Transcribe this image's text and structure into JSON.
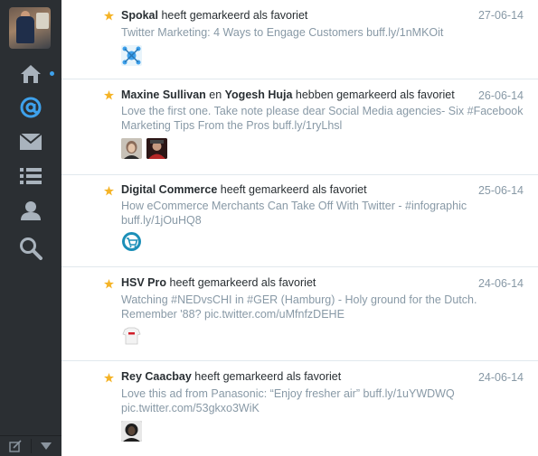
{
  "sidebar": {
    "icons": [
      "home-icon",
      "mentions-icon",
      "messages-icon",
      "lists-icon",
      "profile-icon",
      "search-icon"
    ],
    "accent": "#3ea1ec",
    "icon_color": "#a9b3bd",
    "bottom": [
      "compose-icon",
      "dropdown-icon"
    ]
  },
  "items": [
    {
      "pre": "",
      "b1": "Spokal",
      "mid": "",
      "b2": "",
      "post": " heeft gemarkeerd als favoriet",
      "date": "27-06-14",
      "text": "Twitter Marketing: 4 Ways to Engage Customers buff.ly/1nMKOit"
    },
    {
      "pre": "",
      "b1": "Maxine Sullivan",
      "mid": " en ",
      "b2": "Yogesh Huja",
      "post": " hebben gemarkeerd als favoriet",
      "date": "26-06-14",
      "text": "Love the first one. Take note please dear Social Media agencies- Six #Facebook Marketing Tips From the Pros buff.ly/1ryLhsl"
    },
    {
      "pre": "",
      "b1": "Digital Commerce",
      "mid": "",
      "b2": "",
      "post": " heeft gemarkeerd als favoriet",
      "date": "25-06-14",
      "text": "How eCommerce Merchants Can Take Off With Twitter - #infographic buff.ly/1jOuHQ8"
    },
    {
      "pre": "",
      "b1": "HSV Pro",
      "mid": "",
      "b2": "",
      "post": " heeft gemarkeerd als favoriet",
      "date": "24-06-14",
      "text": "Watching #NEDvsCHI in #GER (Hamburg) - Holy ground for the Dutch. Remember '88? pic.twitter.com/uMfnfzDEHE"
    },
    {
      "pre": "",
      "b1": "Rey Caacbay",
      "mid": "",
      "b2": "",
      "post": " heeft gemarkeerd als favoriet",
      "date": "24-06-14",
      "text": "Love this ad from Panasonic: “Enjoy fresher air” buff.ly/1uYWDWQ pic.twitter.com/53gkxo3WiK"
    }
  ],
  "colors": {
    "star": "#f5b326",
    "date": "#8899a6",
    "text": "#8899a6"
  }
}
